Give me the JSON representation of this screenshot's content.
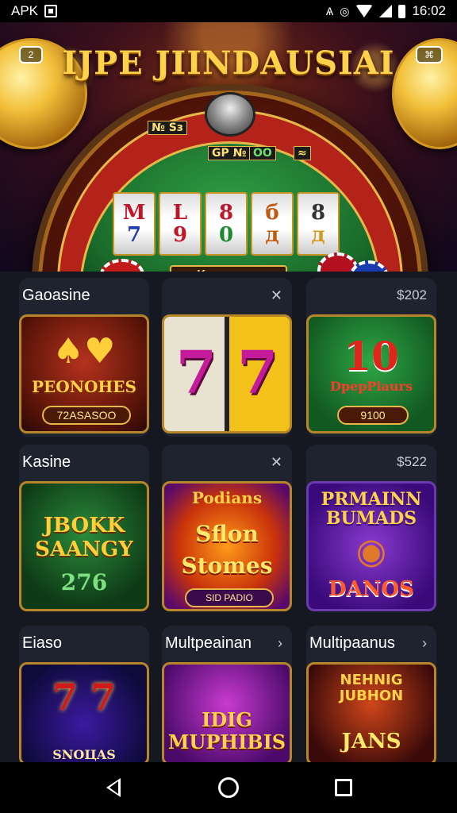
{
  "status_bar": {
    "left_label": "APK",
    "time": "16:02",
    "icons": [
      "screenshot-icon",
      "alarm-icon",
      "do-not-disturb-icon",
      "wifi-icon",
      "signal-icon",
      "battery-icon"
    ]
  },
  "hero": {
    "title": "IJPE JIINDAUSIAI",
    "left_badge": "2",
    "right_badge": "⌘",
    "signs": [
      "№ Ѕз",
      "GP  №",
      "OO",
      "≈"
    ],
    "reels": [
      [
        "M",
        "7"
      ],
      [
        "L",
        "9"
      ],
      [
        "8",
        "0"
      ],
      [
        "б",
        "д"
      ],
      [
        "8",
        "д"
      ]
    ],
    "plaque": "Kasna .coa",
    "colors": {
      "title_gold": "#ffd24a",
      "felt_green": "#2f9e45",
      "table_red": "#b3231a"
    }
  },
  "grid": {
    "rows": [
      {
        "cards": [
          {
            "title": "Gaoasine",
            "meta": "",
            "tile_main": "PEONOHES",
            "tile_sub": "72ASASOO",
            "theme": "cards"
          },
          {
            "title": "",
            "meta": "✕",
            "tile_main": "7  7",
            "tile_sub": "",
            "theme": "sevens"
          },
          {
            "title": "",
            "meta": "$202",
            "tile_main": "10",
            "tile_sub": "DpepPiaurs",
            "pill": "9100",
            "theme": "green-slot"
          }
        ]
      },
      {
        "cards": [
          {
            "title": "Kasine",
            "meta": "",
            "tile_main": "JBOKK SAANGY",
            "tile_sub": "276",
            "theme": "jbokk"
          },
          {
            "title": "",
            "meta": "✕",
            "tile_main": "Sflon Stomes",
            "tile_sub": "Podians",
            "pill": "SID PADIO",
            "theme": "orange-slot"
          },
          {
            "title": "",
            "meta": "$522",
            "tile_main": "PRMAINN BUMADS",
            "tile_sub": "DANOS",
            "theme": "purple-dog"
          }
        ]
      },
      {
        "cards": [
          {
            "title": "Eiaso",
            "meta": "",
            "tile_main": "7 7",
            "tile_sub": "SNOЦAS",
            "theme": "wheel"
          },
          {
            "title": "Multpeainan",
            "meta": "›",
            "tile_main": "IDIG MUPHIBIS",
            "tile_sub": "",
            "theme": "dig"
          },
          {
            "title": "Multipaanus",
            "meta": "›",
            "tile_main": "NEHNIG JUBHON",
            "tile_sub": "JANS",
            "theme": "jans"
          }
        ]
      }
    ]
  },
  "nav_bar": {
    "buttons": [
      "back",
      "home",
      "recents"
    ]
  }
}
